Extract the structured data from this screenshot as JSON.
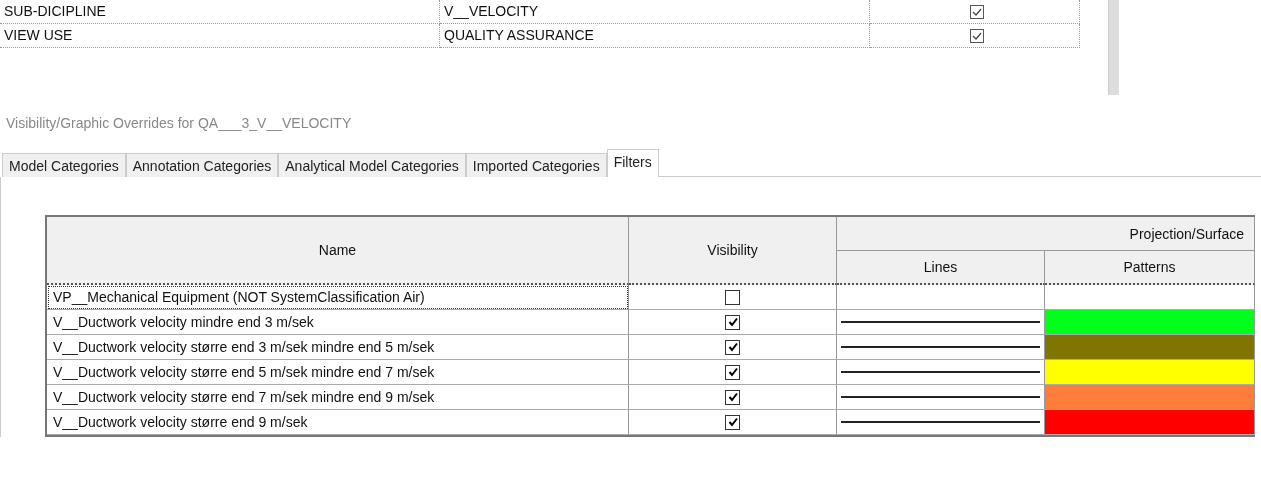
{
  "parameters": [
    {
      "name": "SUB-DICIPLINE",
      "value": "V__VELOCITY",
      "checked": true
    },
    {
      "name": "VIEW USE",
      "value": "QUALITY ASSURANCE",
      "checked": true
    }
  ],
  "dialog": {
    "title": "Visibility/Graphic Overrides for QA___3_V__VELOCITY"
  },
  "tabs": [
    {
      "label": "Model Categories",
      "selected": false
    },
    {
      "label": "Annotation Categories",
      "selected": false
    },
    {
      "label": "Analytical Model Categories",
      "selected": false
    },
    {
      "label": "Imported Categories",
      "selected": false
    },
    {
      "label": "Filters",
      "selected": true
    }
  ],
  "table": {
    "columns": {
      "name": "Name",
      "visibility": "Visibility",
      "group": "Projection/Surface",
      "lines": "Lines",
      "patterns": "Patterns"
    },
    "rows": [
      {
        "name": "VP__Mechanical Equipment (NOT SystemClassification Air)",
        "visible": false,
        "line_override": false,
        "selected": true
      },
      {
        "name": "V__Ductwork velocity mindre end 3 m/sek",
        "visible": true,
        "line_override": true,
        "color": "#00ff1a",
        "selected": false
      },
      {
        "name": "V__Ductwork velocity større end 3 m/sek mindre end 5 m/sek",
        "visible": true,
        "line_override": true,
        "color": "#7f7500",
        "selected": false
      },
      {
        "name": "V__Ductwork velocity større end 5 m/sek mindre end 7 m/sek",
        "visible": true,
        "line_override": true,
        "color": "#ffff00",
        "selected": false
      },
      {
        "name": "V__Ductwork velocity større end 7 m/sek mindre end 9 m/sek",
        "visible": true,
        "line_override": true,
        "color": "#ff7d3a",
        "selected": false
      },
      {
        "name": "V__Ductwork velocity større end 9 m/sek",
        "visible": true,
        "line_override": true,
        "color": "#ff0000",
        "selected": false
      }
    ]
  }
}
